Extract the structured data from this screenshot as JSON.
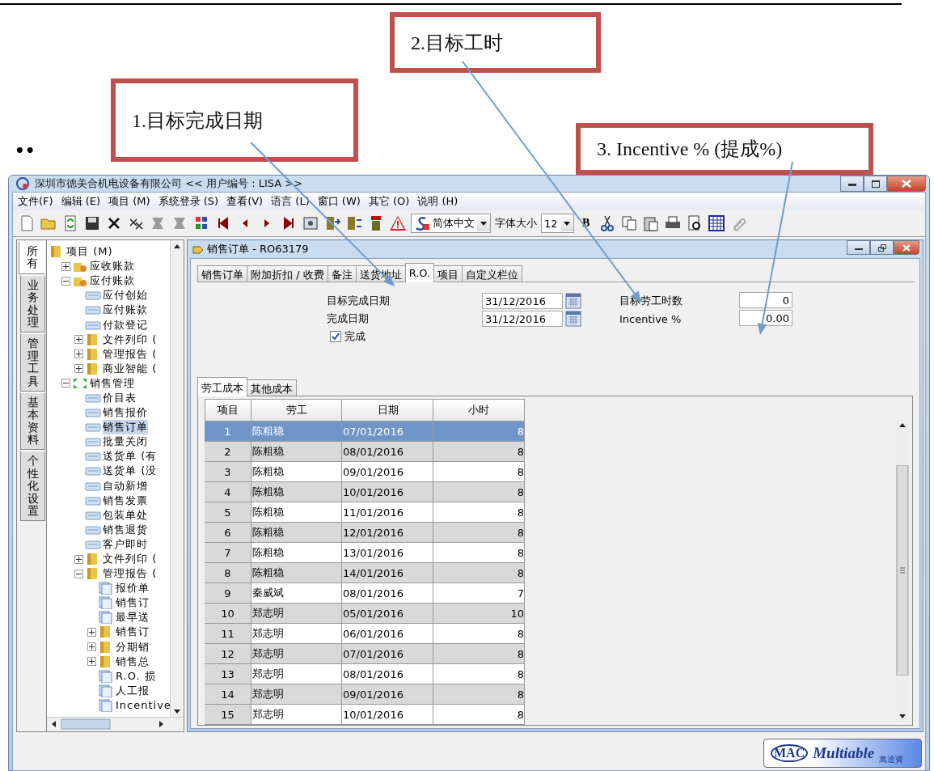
{
  "annotations": [
    {
      "text": "1.目标完成日期"
    },
    {
      "text": "2.目标工时"
    },
    {
      "text": "3. Incentive % (提成%)"
    }
  ],
  "bullet": "••",
  "window": {
    "title": "深圳市德美合机电设备有限公司 << 用户编号 : LISA >>"
  },
  "menu": [
    "文件(F)",
    "编辑 (E)",
    "项目 (M)",
    "系统登录 (S)",
    "查看(V)",
    "语言 (L)",
    "窗口 (W)",
    "其它 (O)",
    "说明 (H)"
  ],
  "toolbar": {
    "language": "简体中文",
    "font_size_label": "字体大小",
    "font_size": "12",
    "bold": "B"
  },
  "side_tabs": [
    {
      "label": "所有",
      "selected": true
    },
    {
      "label": "业务处理",
      "selected": false
    },
    {
      "label": "管理工具",
      "selected": false
    },
    {
      "label": "基本资料",
      "selected": false
    },
    {
      "label": "个性化设置",
      "selected": false
    }
  ],
  "tree": [
    {
      "label": "项目 (M)",
      "kind": "folder",
      "selected": false,
      "children": [
        {
          "label": "应收账款",
          "kind": "money",
          "expanded": false,
          "selected": false
        },
        {
          "label": "应付账款",
          "kind": "money",
          "expanded": true,
          "selected": false,
          "children": [
            {
              "label": "应付创始",
              "kind": "form",
              "selected": false
            },
            {
              "label": "应付账款",
              "kind": "form",
              "selected": false
            },
            {
              "label": "付款登记",
              "kind": "form",
              "selected": false
            },
            {
              "label": "文件列印 (",
              "kind": "folder",
              "expanded": false,
              "selected": false
            },
            {
              "label": "管理报告 (",
              "kind": "folder",
              "expanded": false,
              "selected": false
            },
            {
              "label": "商业智能 (",
              "kind": "folder",
              "expanded": false,
              "selected": false
            }
          ]
        },
        {
          "label": "销售管理",
          "kind": "module",
          "expanded": true,
          "selected": false,
          "children": [
            {
              "label": "价目表",
              "kind": "form",
              "selected": false
            },
            {
              "label": "销售报价",
              "kind": "form",
              "selected": false
            },
            {
              "label": "销售订单",
              "kind": "form",
              "selected": true
            },
            {
              "label": "批量关闭",
              "kind": "form",
              "selected": false
            },
            {
              "label": "送货单 (有",
              "kind": "form",
              "selected": false
            },
            {
              "label": "送货单 (没",
              "kind": "form",
              "selected": false
            },
            {
              "label": "自动新增",
              "kind": "form",
              "selected": false
            },
            {
              "label": "销售发票",
              "kind": "form",
              "selected": false
            },
            {
              "label": "包装单处",
              "kind": "form",
              "selected": false
            },
            {
              "label": "销售退货",
              "kind": "form",
              "selected": false
            },
            {
              "label": "客户即时",
              "kind": "form",
              "selected": false
            },
            {
              "label": "文件列印 (",
              "kind": "folder",
              "expanded": false,
              "selected": false
            },
            {
              "label": "管理报告 (",
              "kind": "folder",
              "expanded": true,
              "selected": false,
              "children": [
                {
                  "label": "报价单",
                  "kind": "report",
                  "selected": false
                },
                {
                  "label": "销售订",
                  "kind": "report",
                  "selected": false
                },
                {
                  "label": "最早送",
                  "kind": "report",
                  "selected": false
                },
                {
                  "label": "销售订",
                  "kind": "folder",
                  "expanded": false,
                  "selected": false
                },
                {
                  "label": "分期销",
                  "kind": "folder",
                  "expanded": false,
                  "selected": false
                },
                {
                  "label": "销售总",
                  "kind": "folder",
                  "expanded": false,
                  "selected": false
                },
                {
                  "label": "R.O. 损",
                  "kind": "report",
                  "selected": false
                },
                {
                  "label": "人工报",
                  "kind": "report",
                  "selected": false
                },
                {
                  "label": "Incentive",
                  "kind": "report",
                  "selected": false
                }
              ]
            }
          ]
        }
      ]
    }
  ],
  "document": {
    "title": "销售订单 - RO63179",
    "tabs": [
      {
        "label": "销售订单",
        "selected": false
      },
      {
        "label": "附加折扣 / 收费",
        "selected": false
      },
      {
        "label": "备注",
        "selected": false
      },
      {
        "label": "送货地址",
        "selected": false
      },
      {
        "label": "R.O.",
        "selected": true
      },
      {
        "label": "项目",
        "selected": false
      },
      {
        "label": "自定义栏位",
        "selected": false
      }
    ],
    "target_date": {
      "label": "目标完成日期",
      "value": "31/12/2016"
    },
    "completion_date": {
      "label": "完成日期",
      "value": "31/12/2016"
    },
    "completed": {
      "label": "完成",
      "checked": true
    },
    "target_hours": {
      "label": "目标劳工时数",
      "value": "0"
    },
    "incentive": {
      "label": "Incentive %",
      "value": "0.00"
    },
    "sub_tabs": [
      {
        "label": "劳工成本",
        "selected": true
      },
      {
        "label": "其他成本",
        "selected": false
      }
    ],
    "grid": {
      "columns": [
        "项目",
        "劳工",
        "日期",
        "小时"
      ],
      "rows": [
        {
          "cells": [
            "1",
            "陈粗稳",
            "07/01/2016",
            "8"
          ],
          "selected": true
        },
        {
          "cells": [
            "2",
            "陈粗稳",
            "08/01/2016",
            "8"
          ],
          "selected": false
        },
        {
          "cells": [
            "3",
            "陈粗稳",
            "09/01/2016",
            "8"
          ],
          "selected": false
        },
        {
          "cells": [
            "4",
            "陈粗稳",
            "10/01/2016",
            "8"
          ],
          "selected": false
        },
        {
          "cells": [
            "5",
            "陈粗稳",
            "11/01/2016",
            "8"
          ],
          "selected": false
        },
        {
          "cells": [
            "6",
            "陈粗稳",
            "12/01/2016",
            "8"
          ],
          "selected": false
        },
        {
          "cells": [
            "7",
            "陈粗稳",
            "13/01/2016",
            "8"
          ],
          "selected": false
        },
        {
          "cells": [
            "8",
            "陈粗稳",
            "14/01/2016",
            "8"
          ],
          "selected": false
        },
        {
          "cells": [
            "9",
            "秦威斌",
            "08/01/2016",
            "7"
          ],
          "selected": false
        },
        {
          "cells": [
            "10",
            "郑志明",
            "05/01/2016",
            "10"
          ],
          "selected": false
        },
        {
          "cells": [
            "11",
            "郑志明",
            "06/01/2016",
            "8"
          ],
          "selected": false
        },
        {
          "cells": [
            "12",
            "郑志明",
            "07/01/2016",
            "8"
          ],
          "selected": false
        },
        {
          "cells": [
            "13",
            "郑志明",
            "08/01/2016",
            "8"
          ],
          "selected": false
        },
        {
          "cells": [
            "14",
            "郑志明",
            "09/01/2016",
            "8"
          ],
          "selected": false
        },
        {
          "cells": [
            "15",
            "郑志明",
            "10/01/2016",
            "8"
          ],
          "selected": false
        }
      ]
    }
  },
  "status_bar": {
    "logo_mark": "MAC",
    "logo": "Multiable",
    "logo_sub": "萬達寶"
  }
}
